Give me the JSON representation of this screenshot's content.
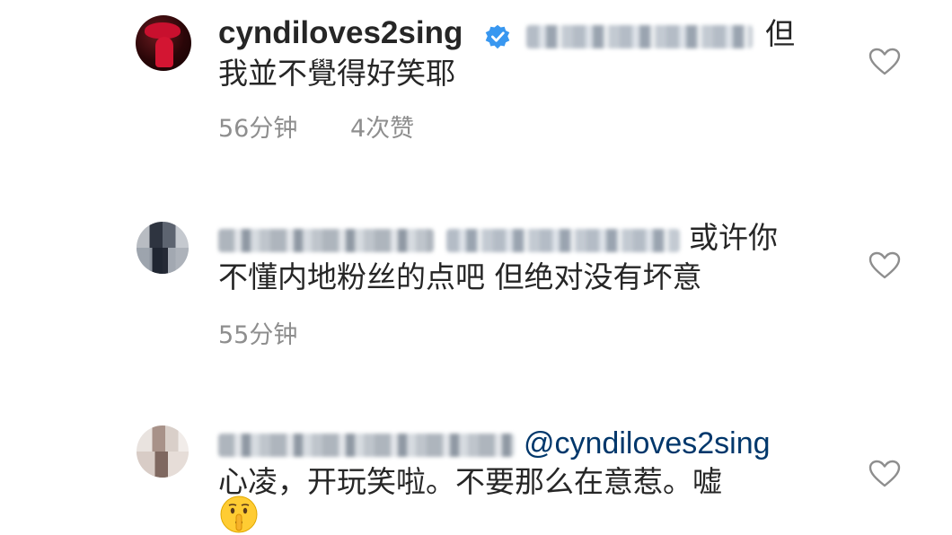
{
  "comments": [
    {
      "username": "cyndiloves2sing",
      "verified": true,
      "text_end_line1": "但",
      "text_line2": "我並不覺得好笑耶",
      "time": "56分钟",
      "likes": "4次赞"
    },
    {
      "text_end_line1": "或许你",
      "text_line2": "不懂内地粉丝的点吧 但绝对没有坏意",
      "time": "55分钟"
    },
    {
      "mention": "@cyndiloves2sing",
      "text_line2": "心凌，开玩笑啦。不要那么在意惹。嘘",
      "emoji": "🤫"
    }
  ],
  "colors": {
    "text": "#262626",
    "meta": "#8e8e8e",
    "mention": "#00376b",
    "verified": "#3897f0"
  },
  "icons": [
    "verified-badge-icon",
    "heart-icon",
    "shushing-face-emoji"
  ]
}
